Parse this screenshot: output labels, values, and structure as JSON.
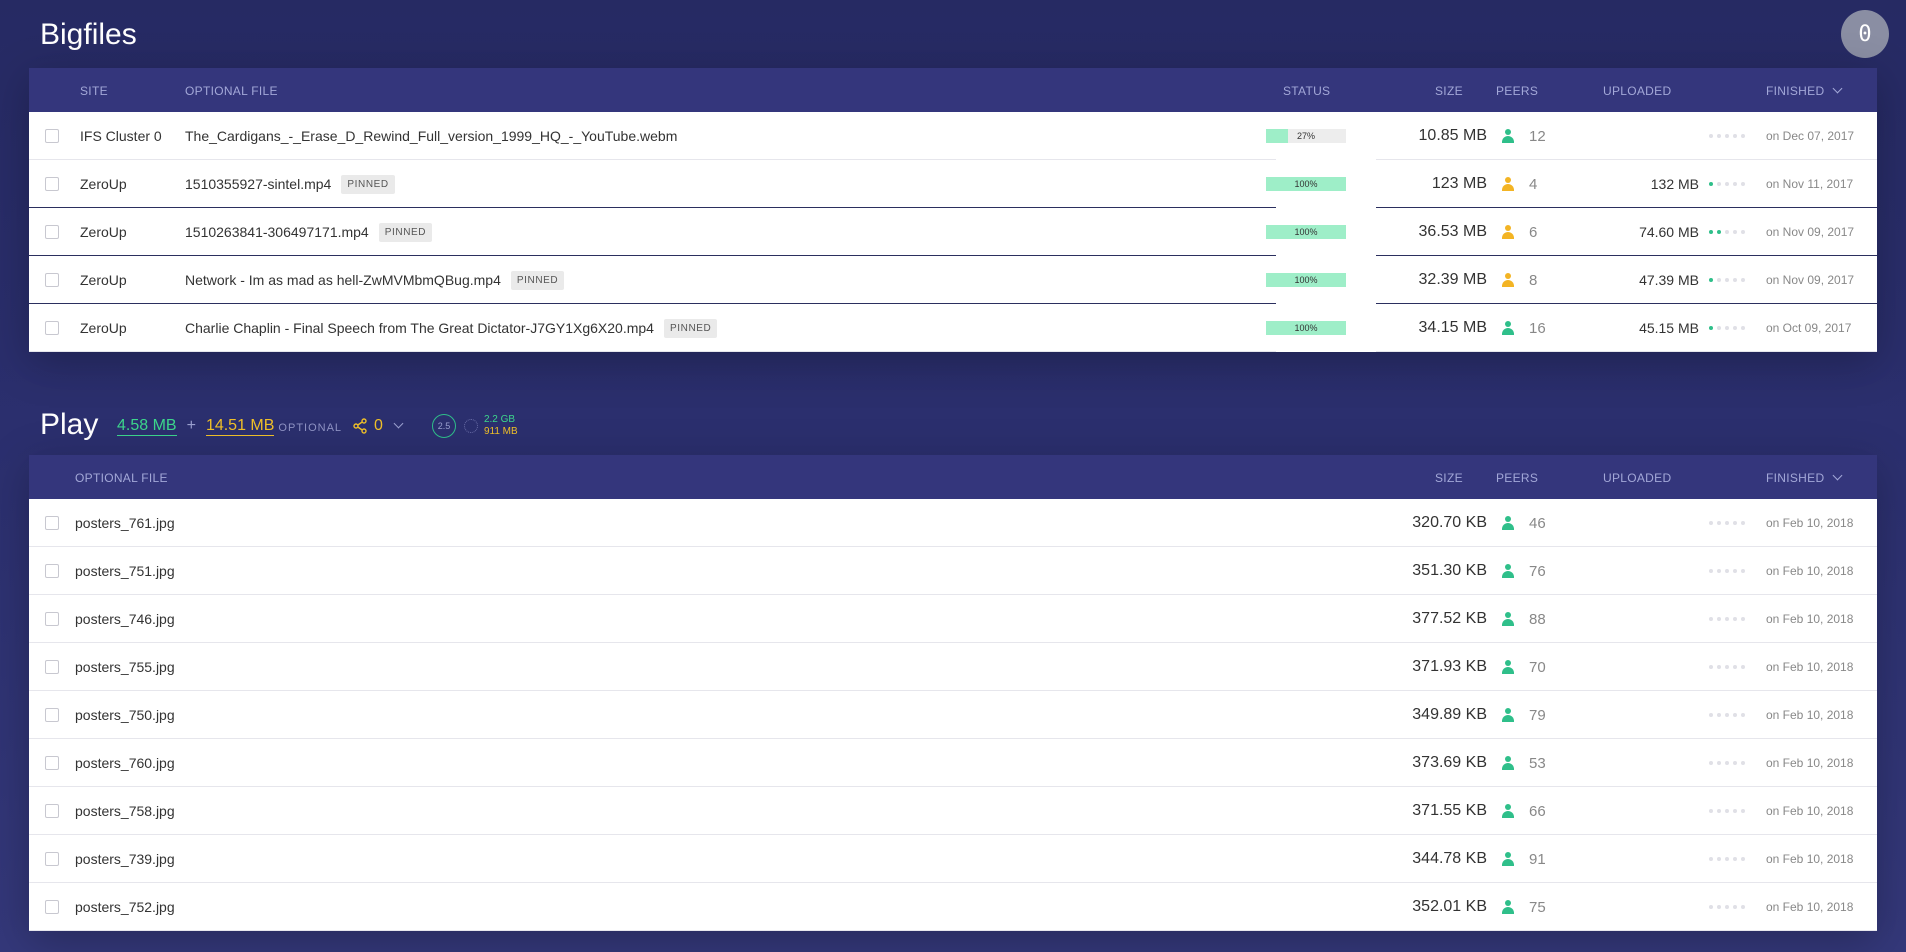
{
  "notification_count": "0",
  "bigfiles": {
    "title": "Bigfiles",
    "headers": {
      "site": "SITE",
      "optional_file": "OPTIONAL FILE",
      "status": "STATUS",
      "size": "SIZE",
      "peers": "PEERS",
      "uploaded": "UPLOADED",
      "finished": "FINISHED"
    },
    "rows": [
      {
        "site": "IFS Cluster 0",
        "file": "The_Cardigans_-_Erase_D_Rewind_Full_version_1999_HQ_-_YouTube.webm",
        "pinned": "",
        "status": "27%",
        "progress": 0.27,
        "size": "10.85 MB",
        "peers": "12",
        "peer_color": "green",
        "uploaded": "",
        "upload_dots": 0,
        "finished": "on Dec 07, 2017"
      },
      {
        "site": "ZeroUp",
        "file": "1510355927-sintel.mp4",
        "pinned": "PINNED",
        "status": "100%",
        "progress": 1.0,
        "size": "123 MB",
        "peers": "4",
        "peer_color": "orange",
        "uploaded": "132 MB",
        "upload_dots": 1,
        "finished": "on Nov 11, 2017"
      },
      {
        "site": "ZeroUp",
        "file": "1510263841-306497171.mp4",
        "pinned": "PINNED",
        "status": "100%",
        "progress": 1.0,
        "size": "36.53 MB",
        "peers": "6",
        "peer_color": "orange",
        "uploaded": "74.60 MB",
        "upload_dots": 2,
        "finished": "on Nov 09, 2017"
      },
      {
        "site": "ZeroUp",
        "file": "Network - Im as mad as hell-ZwMVMbmQBug.mp4",
        "pinned": "PINNED",
        "status": "100%",
        "progress": 1.0,
        "size": "32.39 MB",
        "peers": "8",
        "peer_color": "orange",
        "uploaded": "47.39 MB",
        "upload_dots": 1,
        "finished": "on Nov 09, 2017"
      },
      {
        "site": "ZeroUp",
        "file": "Charlie Chaplin - Final Speech from The Great Dictator-J7GY1Xg6X20.mp4",
        "pinned": "PINNED",
        "status": "100%",
        "progress": 1.0,
        "size": "34.15 MB",
        "peers": "16",
        "peer_color": "green",
        "uploaded": "45.15 MB",
        "upload_dots": 1,
        "finished": "on Oct 09, 2017"
      }
    ]
  },
  "play": {
    "title": "Play",
    "downloaded": "4.58 MB",
    "plus": "+",
    "optional_size": "14.51 MB",
    "optional_label": "OPTIONAL",
    "share_count": "0",
    "ring_value": "2.5",
    "disk_total": "2.2 GB",
    "disk_used": "911 MB",
    "headers": {
      "optional_file": "OPTIONAL FILE",
      "size": "SIZE",
      "peers": "PEERS",
      "uploaded": "UPLOADED",
      "finished": "FINISHED"
    },
    "rows": [
      {
        "file": "posters_761.jpg",
        "size": "320.70 KB",
        "peers": "46",
        "finished": "on Feb 10, 2018"
      },
      {
        "file": "posters_751.jpg",
        "size": "351.30 KB",
        "peers": "76",
        "finished": "on Feb 10, 2018"
      },
      {
        "file": "posters_746.jpg",
        "size": "377.52 KB",
        "peers": "88",
        "finished": "on Feb 10, 2018"
      },
      {
        "file": "posters_755.jpg",
        "size": "371.93 KB",
        "peers": "70",
        "finished": "on Feb 10, 2018"
      },
      {
        "file": "posters_750.jpg",
        "size": "349.89 KB",
        "peers": "79",
        "finished": "on Feb 10, 2018"
      },
      {
        "file": "posters_760.jpg",
        "size": "373.69 KB",
        "peers": "53",
        "finished": "on Feb 10, 2018"
      },
      {
        "file": "posters_758.jpg",
        "size": "371.55 KB",
        "peers": "66",
        "finished": "on Feb 10, 2018"
      },
      {
        "file": "posters_739.jpg",
        "size": "344.78 KB",
        "peers": "91",
        "finished": "on Feb 10, 2018"
      },
      {
        "file": "posters_752.jpg",
        "size": "352.01 KB",
        "peers": "75",
        "finished": "on Feb 10, 2018"
      }
    ]
  },
  "colors": {
    "peer_green": "#2fbf8a",
    "peer_orange": "#f3b424",
    "progress_fill": "#9eeec8",
    "header_bg": "#34367c"
  },
  "icons": {
    "notification": "notification-count-badge",
    "peer": "user-icon",
    "share": "share-icon",
    "chevron": "chevron-down-icon"
  }
}
